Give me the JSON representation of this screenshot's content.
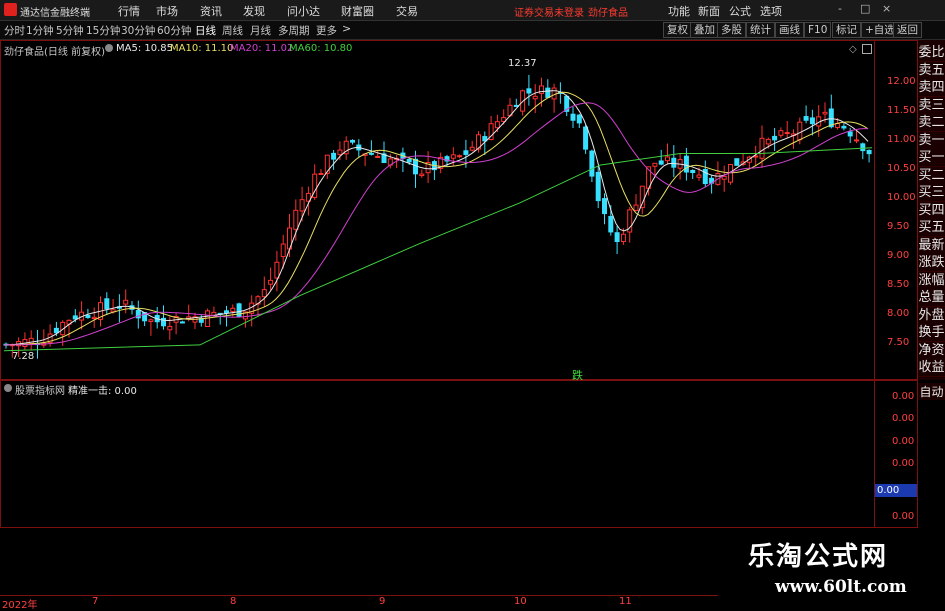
{
  "app": {
    "title": "通达信金融终端"
  },
  "menu": [
    "行情",
    "市场",
    "资讯",
    "发现",
    "问小达",
    "财富圈",
    "交易"
  ],
  "notice": {
    "login": "证券交易未登录",
    "stock": "劲仔食品"
  },
  "right_menu": [
    "功能",
    "新面",
    "公式",
    "选项"
  ],
  "window_controls": [
    "-",
    "□",
    "×"
  ],
  "periods": [
    "分时",
    "1分钟",
    "5分钟",
    "15分钟",
    "30分钟",
    "60分钟",
    "日线",
    "周线",
    "月线",
    "多周期",
    "更多"
  ],
  "active_period": "日线",
  "right_tools": [
    "复权",
    "叠加",
    "多股",
    "统计",
    "画线",
    "F10",
    "标记",
    "+自选",
    "返回"
  ],
  "chart": {
    "stock_label": "劲仔食品(日线 前复权)",
    "ma": [
      {
        "text": "MA5: 10.85",
        "color": "#e8e8e8"
      },
      {
        "text": "MA10: 11.10",
        "color": "#e8e060"
      },
      {
        "text": "MA20: 11.02",
        "color": "#d040d0"
      },
      {
        "text": "MA60: 10.80",
        "color": "#40d040"
      }
    ],
    "y_ticks": [
      "12.00",
      "11.50",
      "11.00",
      "10.50",
      "10.00",
      "9.50",
      "9.00",
      "8.50",
      "8.00",
      "7.50"
    ],
    "high_label": "12.37",
    "low_label": "7.28",
    "signal_label": "跌",
    "colors": {
      "up": "#ff3030",
      "down": "#38e0ff",
      "ma5": "#e8e8e8",
      "ma10": "#e8e060",
      "ma20": "#d040d0",
      "ma60": "#40d040"
    }
  },
  "side_panel": [
    "委比",
    "卖五",
    "卖四",
    "卖三",
    "卖二",
    "卖一",
    "买一",
    "买二",
    "买三",
    "买四",
    "买五",
    "最新",
    "涨跌",
    "涨幅",
    "总量",
    "外盘",
    "换手",
    "净资",
    "收益"
  ],
  "indicator": {
    "label": "股票指标网",
    "formula": "精准一击: 0.00",
    "auto_label": "自动",
    "y_ticks": [
      "0.00",
      "0.00",
      "0.00",
      "0.00",
      "0.00",
      "0.00"
    ],
    "current_value": "0.00"
  },
  "x_axis": [
    "2022年",
    "7",
    "8",
    "9",
    "10",
    "11"
  ],
  "watermark": {
    "title": "乐淘公式网",
    "url": "www.60lt.com"
  }
}
